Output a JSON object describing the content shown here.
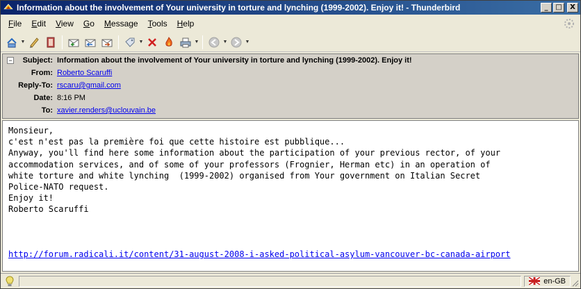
{
  "window": {
    "title": "Information about the involvement of Your university in torture and lynching (1999-2002). Enjoy it! - Thunderbird",
    "minimize": "_",
    "maximize": "□",
    "close": "X"
  },
  "menu": {
    "items": [
      {
        "label": "File",
        "key": "F",
        "rest": "ile"
      },
      {
        "label": "Edit",
        "key": "E",
        "rest": "dit"
      },
      {
        "label": "View",
        "key": "V",
        "rest": "iew"
      },
      {
        "label": "Go",
        "key": "G",
        "rest": "o"
      },
      {
        "label": "Message",
        "key": "M",
        "rest": "essage"
      },
      {
        "label": "Tools",
        "key": "T",
        "rest": "ools"
      },
      {
        "label": "Help",
        "key": "H",
        "rest": "elp"
      }
    ]
  },
  "toolbar": {
    "icons": [
      "get-mail-icon",
      "write-icon",
      "address-book-icon",
      "reply-icon",
      "reply-all-icon",
      "forward-icon",
      "tag-icon",
      "delete-icon",
      "junk-icon",
      "print-icon",
      "back-icon",
      "forward-nav-icon"
    ]
  },
  "headers": {
    "subject_label": "Subject:",
    "subject": "Information about the involvement of Your university in torture and lynching (1999-2002). Enjoy it!",
    "from_label": "From:",
    "from": "Roberto Scaruffi",
    "replyto_label": "Reply-To:",
    "replyto": "rscaru@gmail.com",
    "date_label": "Date:",
    "date": "8:16 PM",
    "to_label": "To:",
    "to": "xavier.renders@uclouvain.be"
  },
  "body": {
    "lines": [
      "Monsieur,",
      "c'est n'est pas la première foi que cette histoire est pubblique...",
      "Anyway, you'll find here some information about the participation of your previous rector, of your",
      "accommodation services, and of some of your professors (Frognier, Herman etc) in an operation of",
      "white torture and white lynching  (1999-2002) organised from Your government on Italian Secret",
      "Police-NATO request.",
      "Enjoy it!",
      "Roberto Scaruffi",
      "",
      "",
      ""
    ],
    "link": "http://forum.radicali.it/content/31-august-2008-i-asked-political-asylum-vancouver-bc-canada-airport"
  },
  "status": {
    "language": "en-GB"
  },
  "colors": {
    "titlebar": "#0a246a",
    "link": "#0000ee",
    "chrome": "#ece9d8"
  }
}
